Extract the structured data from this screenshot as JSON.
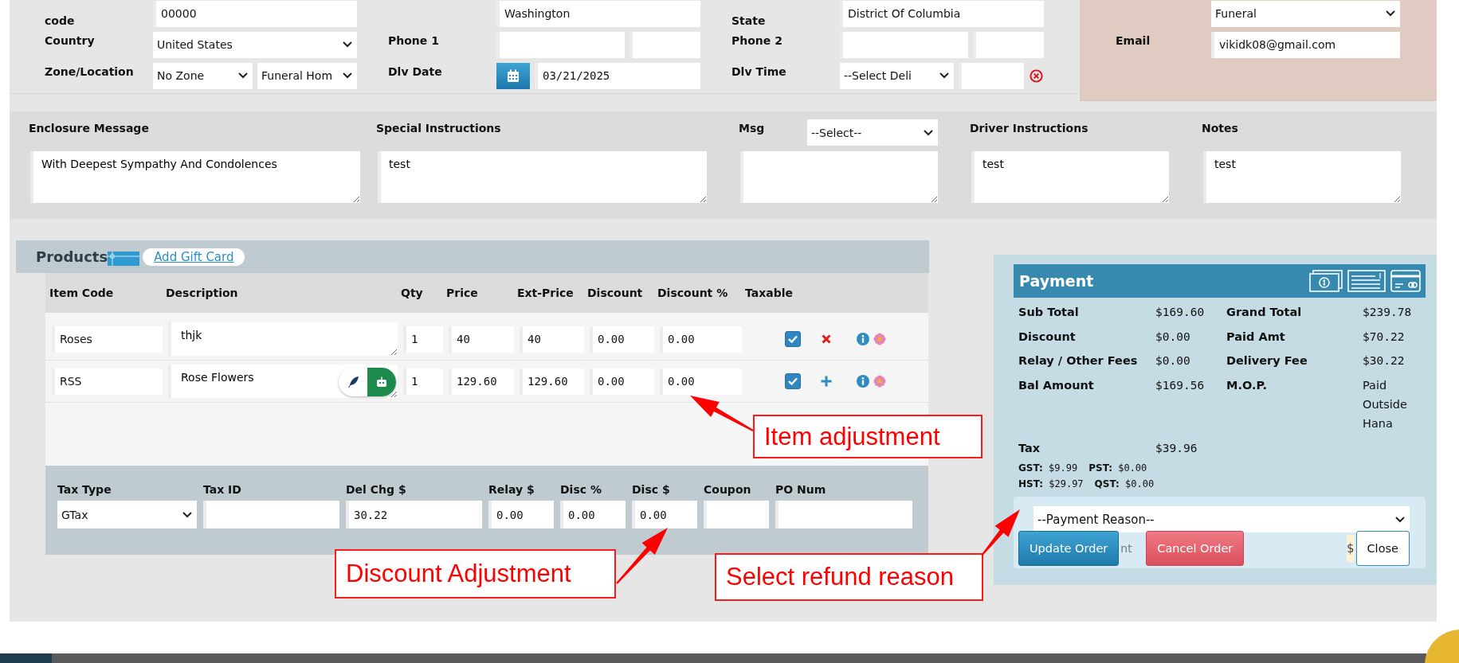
{
  "address": {
    "rows": [
      {
        "cells": [
          {
            "label": "code",
            "fields": [
              {
                "kind": "text",
                "value": "00000"
              }
            ]
          },
          {
            "fields": [
              {
                "kind": "text",
                "value": "Washington"
              }
            ]
          },
          {
            "label": "State",
            "fields": [
              {
                "kind": "text",
                "value": "District Of Columbia"
              }
            ]
          }
        ]
      },
      {
        "cells": [
          {
            "label": "Country",
            "fields": [
              {
                "kind": "select",
                "value": "United States"
              }
            ]
          },
          {
            "label": "Phone 1",
            "fields": [
              {
                "kind": "text"
              },
              {
                "kind": "text"
              }
            ]
          },
          {
            "label": "Phone 2",
            "fields": [
              {
                "kind": "text"
              },
              {
                "kind": "text"
              }
            ]
          }
        ]
      },
      {
        "cells": [
          {
            "label": "Zone/Location",
            "fields": [
              {
                "kind": "select",
                "value": "No Zone"
              },
              {
                "kind": "select",
                "value": "Funeral Hom"
              }
            ]
          },
          {
            "label": "Dlv Date",
            "fields": [
              {
                "kind": "date",
                "value": "03/21/2025"
              }
            ]
          },
          {
            "label": "Dlv Time",
            "fields": [
              {
                "kind": "select",
                "value": "--Select Deli"
              },
              {
                "kind": "text"
              },
              {
                "kind": "clear"
              }
            ]
          }
        ]
      }
    ]
  },
  "contact": {
    "fields": [
      {
        "kind": "select",
        "value": "Funeral"
      },
      {
        "label": "Email",
        "kind": "text",
        "value": "vikidk08@gmail.com"
      }
    ]
  },
  "messages": [
    {
      "label": "Enclosure Message",
      "value": "With Deepest Sympathy And Condolences"
    },
    {
      "label": "Special Instructions",
      "value": "test"
    },
    {
      "label": "Msg",
      "select": "--Select--"
    },
    {
      "label": "Driver Instructions",
      "value": "test"
    },
    {
      "label": "Notes",
      "value": "test"
    }
  ],
  "products": {
    "title": "Products",
    "gift_card_link": "Add Gift Card",
    "columns": [
      "Item Code",
      "Description",
      "Qty",
      "Price",
      "Ext-Price",
      "Discount",
      "Discount %",
      "Taxable"
    ],
    "rows": [
      {
        "item_code": "Roses",
        "description": "thjk",
        "qty": "1",
        "price": "40",
        "ext_price": "40",
        "discount": "0.00",
        "discount_pct": "0.00",
        "taxable": true,
        "kind": "delete",
        "assistant_badge": false
      },
      {
        "item_code": "RSS",
        "description": "Rose Flowers",
        "qty": "1",
        "price": "129.60",
        "ext_price": "129.60",
        "discount": "0.00",
        "discount_pct": "0.00",
        "taxable": true,
        "kind": "add",
        "assistant_badge": true
      }
    ]
  },
  "tax_panel": {
    "fields": [
      {
        "label": "Tax Type",
        "kind": "select",
        "value": "GTax"
      },
      {
        "label": "Tax ID",
        "kind": "text"
      },
      {
        "label": "Del Chg $",
        "kind": "text",
        "value": "30.22"
      },
      {
        "label": "Relay $",
        "kind": "text",
        "value": "0.00"
      },
      {
        "label": "Disc %",
        "kind": "text",
        "value": "0.00"
      },
      {
        "label": "Disc $",
        "kind": "text",
        "value": "0.00"
      },
      {
        "label": "Coupon",
        "kind": "text"
      },
      {
        "label": "PO Num",
        "kind": "text"
      }
    ]
  },
  "payment": {
    "title": "Payment",
    "summary": [
      {
        "label": "Sub Total",
        "value": "$169.60"
      },
      {
        "label": "Grand Total",
        "value": "$239.78"
      },
      {
        "label": "Discount",
        "value": "$0.00"
      },
      {
        "label": "Paid Amt",
        "value": "$70.22"
      },
      {
        "label": "Relay / Other Fees",
        "value": "$0.00"
      },
      {
        "label": "Delivery Fee",
        "value": "$30.22"
      },
      {
        "label": "Bal Amount",
        "value": "$169.56"
      },
      {
        "label": "M.O.P.",
        "value": "Paid Outside Hana"
      }
    ],
    "tax": {
      "label": "Tax",
      "value": "$39.96"
    },
    "tax_breakdown": [
      [
        {
          "label": "GST:",
          "value": "$9.99"
        },
        {
          "label": "PST:",
          "value": "$0.00"
        }
      ],
      [
        {
          "label": "HST:",
          "value": "$29.97"
        },
        {
          "label": "QST:",
          "value": "$0.00"
        }
      ]
    ],
    "reason_placeholder": "--Payment Reason--",
    "hidden_note": "nt",
    "amount_prefix": "$",
    "buttons": [
      {
        "label": "Update Order",
        "kind": "primary"
      },
      {
        "label": "Cancel Order",
        "kind": "danger"
      },
      {
        "label": "Close",
        "kind": "plain"
      }
    ]
  },
  "annotations": [
    {
      "text": "Item adjustment"
    },
    {
      "text": "Discount Adjustment"
    },
    {
      "text": "Select refund reason"
    }
  ]
}
